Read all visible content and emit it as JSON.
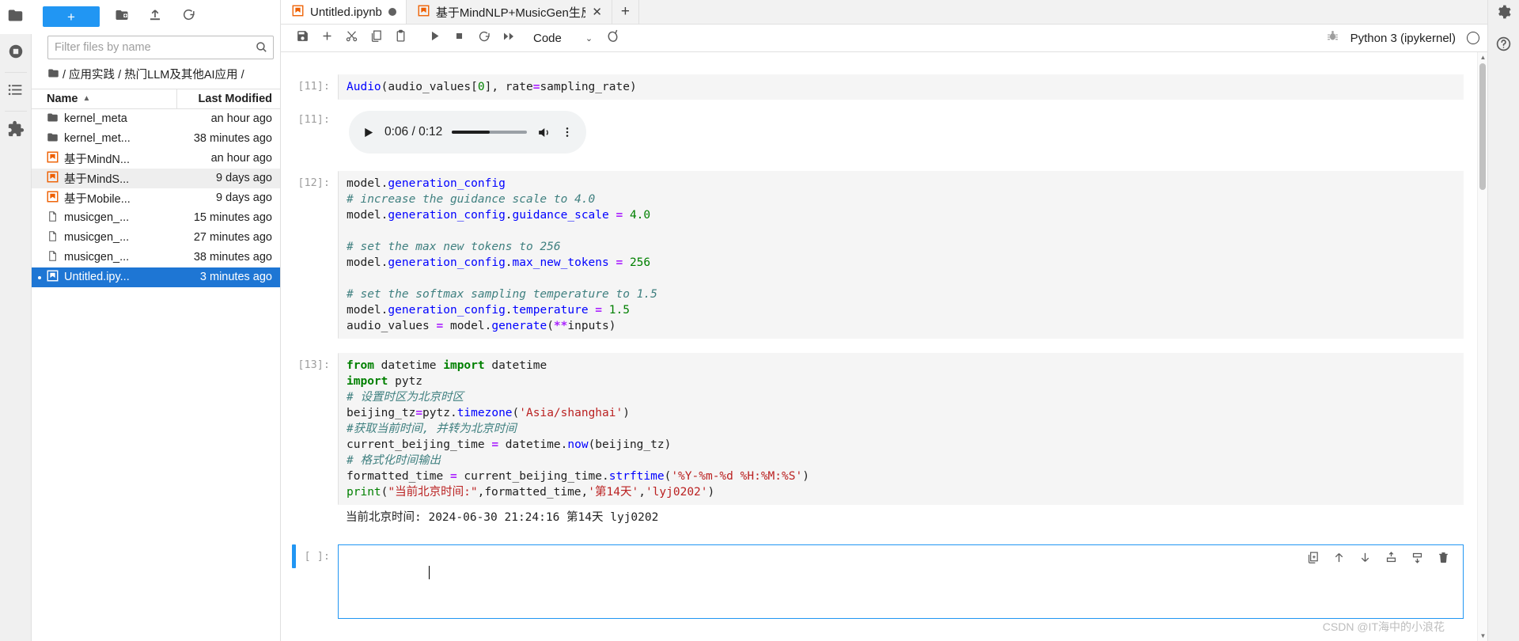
{
  "activity_bar": {
    "items": [
      {
        "name": "file-browser-icon",
        "label": "File Browser"
      },
      {
        "name": "running-terminals-icon",
        "label": "Running Terminals and Kernels"
      },
      {
        "name": "table-of-contents-icon",
        "label": "Table of Contents"
      },
      {
        "name": "extension-manager-icon",
        "label": "Extension Manager"
      }
    ]
  },
  "right_rail": {
    "items": [
      {
        "name": "settings-icon",
        "label": "Settings"
      },
      {
        "name": "help-icon",
        "label": "Help"
      }
    ]
  },
  "file_browser": {
    "toolbar": {
      "new_launcher_label": "+",
      "new_folder_label": "New Folder",
      "upload_label": "Upload Files",
      "refresh_label": "Refresh File List"
    },
    "filter": {
      "placeholder": "Filter files by name",
      "value": ""
    },
    "breadcrumb": "/ 应用实践 / 热门LLM及其他AI应用 /",
    "columns": {
      "name": "Name",
      "last_modified": "Last Modified"
    },
    "sort_indicator": "▲",
    "items": [
      {
        "name": "kernel_meta",
        "modified": "an hour ago",
        "type": "folder",
        "state": "normal"
      },
      {
        "name": "kernel_met...",
        "modified": "38 minutes ago",
        "type": "folder",
        "state": "normal"
      },
      {
        "name": "基于MindN...",
        "modified": "an hour ago",
        "type": "notebook",
        "state": "normal"
      },
      {
        "name": "基于MindS...",
        "modified": "9 days ago",
        "type": "notebook",
        "state": "hover"
      },
      {
        "name": "基于Mobile...",
        "modified": "9 days ago",
        "type": "notebook",
        "state": "normal"
      },
      {
        "name": "musicgen_...",
        "modified": "15 minutes ago",
        "type": "file",
        "state": "normal"
      },
      {
        "name": "musicgen_...",
        "modified": "27 minutes ago",
        "type": "file",
        "state": "normal"
      },
      {
        "name": "musicgen_...",
        "modified": "38 minutes ago",
        "type": "file",
        "state": "normal"
      },
      {
        "name": "Untitled.ipy...",
        "modified": "3 minutes ago",
        "type": "notebook",
        "state": "selected"
      }
    ]
  },
  "tabs": [
    {
      "label": "Untitled.ipynb",
      "icon": "notebook-icon",
      "active": true,
      "dirty": true
    },
    {
      "label": "基于MindNLP+MusicGen生反",
      "icon": "notebook-icon",
      "active": false,
      "dirty": false
    }
  ],
  "tab_add_label": "+",
  "notebook_toolbar": {
    "buttons": [
      {
        "name": "save-button",
        "label": "Save"
      },
      {
        "name": "insert-cell-button",
        "label": "Insert a cell below"
      },
      {
        "name": "cut-cells-button",
        "label": "Cut"
      },
      {
        "name": "copy-cells-button",
        "label": "Copy"
      },
      {
        "name": "paste-cells-button",
        "label": "Paste"
      },
      {
        "name": "run-cell-button",
        "label": "Run"
      },
      {
        "name": "interrupt-kernel-button",
        "label": "Interrupt the kernel"
      },
      {
        "name": "restart-kernel-button",
        "label": "Restart the kernel"
      },
      {
        "name": "restart-run-all-button",
        "label": "Restart and run all cells"
      }
    ],
    "cell_type": "Code",
    "cell_type_caret": "⌄",
    "git_label": "Git"
  },
  "kernel_status": {
    "debugger_label": "Debugger",
    "kernel_name": "Python 3 (ipykernel)",
    "busy": false
  },
  "notebook": {
    "cells": [
      {
        "prompt": "[11]:",
        "type": "code",
        "source": "Audio(audio_values[0], rate=sampling_rate)",
        "output": {
          "prompt": "[11]:",
          "type": "audio",
          "current_time": "0:06",
          "duration": "0:12",
          "time_display": "0:06 / 0:12",
          "progress_percent": 50
        }
      },
      {
        "prompt": "[12]:",
        "type": "code",
        "source": "model.generation_config\n# increase the guidance scale to 4.0\nmodel.generation_config.guidance_scale = 4.0\n\n# set the max new tokens to 256\nmodel.generation_config.max_new_tokens = 256\n\n# set the softmax sampling temperature to 1.5\nmodel.generation_config.temperature = 1.5\naudio_values = model.generate(**inputs)"
      },
      {
        "prompt": "[13]:",
        "type": "code",
        "source": "from datetime import datetime\nimport pytz\n# 设置时区为北京时区\nbeijing_tz=pytz.timezone('Asia/shanghai')\n#获取当前时间, 并转为北京时间\ncurrent_beijing_time = datetime.now(beijing_tz)\n# 格式化时间输出\nformatted_time = current_beijing_time.strftime('%Y-%m-%d %H:%M:%S')\nprint(\"当前北京时间:\",formatted_time,'第14天','lyj0202')",
        "output": {
          "type": "stream",
          "text": "当前北京时间: 2024-06-30 21:24:16 第14天 lyj0202"
        }
      },
      {
        "prompt": "[ ]:",
        "type": "code",
        "source": "",
        "active": true
      }
    ],
    "active_cell_toolbar": [
      {
        "name": "duplicate-cell-icon",
        "label": "Duplicate this cell"
      },
      {
        "name": "move-cell-up-icon",
        "label": "Move this cell up"
      },
      {
        "name": "move-cell-down-icon",
        "label": "Move this cell down"
      },
      {
        "name": "insert-cell-above-icon",
        "label": "Insert a cell above"
      },
      {
        "name": "insert-cell-below-icon",
        "label": "Insert a cell below"
      },
      {
        "name": "delete-cell-icon",
        "label": "Delete this cell"
      }
    ]
  },
  "watermark": "CSDN @IT海中的小浪花",
  "colors": {
    "accent_blue": "#2196f3",
    "selection_blue": "#1e76d4",
    "notebook_orange": "#ee6002",
    "cell_bg": "#f5f5f5",
    "panel_bg": "#f0f0f0"
  }
}
